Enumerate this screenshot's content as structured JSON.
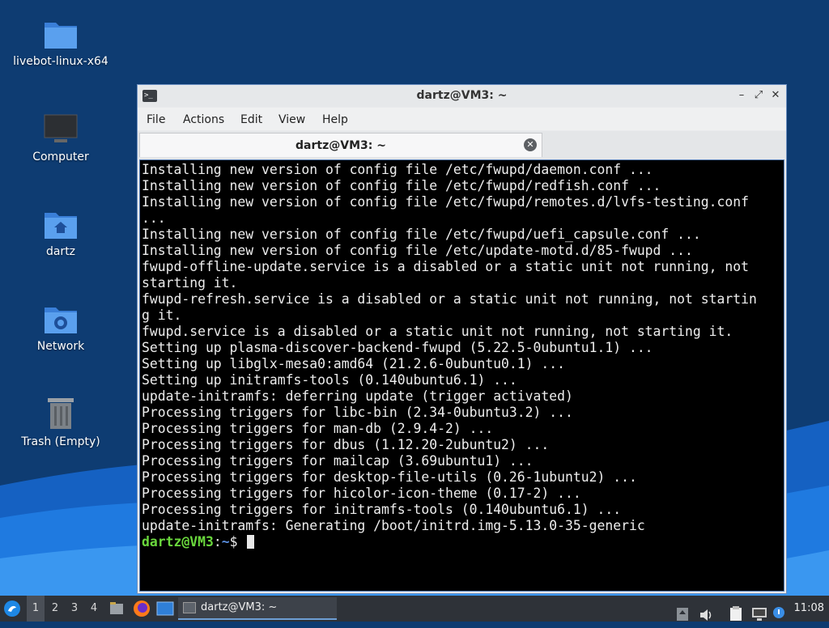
{
  "desktop": {
    "icons": [
      {
        "label": "livebot-linux-x64",
        "icon": "folder-icon"
      },
      {
        "label": "Computer",
        "icon": "computer-icon"
      },
      {
        "label": "dartz",
        "icon": "home-folder-icon"
      },
      {
        "label": "Network",
        "icon": "network-folder-icon"
      },
      {
        "label": "Trash (Empty)",
        "icon": "trash-icon"
      }
    ]
  },
  "window": {
    "title": "dartz@VM3: ~",
    "controls": {
      "minimize": "–",
      "maximize": "⤢",
      "close": "✕"
    },
    "menu": [
      "File",
      "Actions",
      "Edit",
      "View",
      "Help"
    ],
    "tab_title": "dartz@VM3: ~",
    "tab_close": "✕"
  },
  "terminal": {
    "lines": [
      "Installing new version of config file /etc/fwupd/daemon.conf ...",
      "Installing new version of config file /etc/fwupd/redfish.conf ...",
      "Installing new version of config file /etc/fwupd/remotes.d/lvfs-testing.conf",
      "...",
      "Installing new version of config file /etc/fwupd/uefi_capsule.conf ...",
      "Installing new version of config file /etc/update-motd.d/85-fwupd ...",
      "fwupd-offline-update.service is a disabled or a static unit not running, not",
      "starting it.",
      "fwupd-refresh.service is a disabled or a static unit not running, not startin",
      "g it.",
      "fwupd.service is a disabled or a static unit not running, not starting it.",
      "Setting up plasma-discover-backend-fwupd (5.22.5-0ubuntu1.1) ...",
      "Setting up libglx-mesa0:amd64 (21.2.6-0ubuntu0.1) ...",
      "Setting up initramfs-tools (0.140ubuntu6.1) ...",
      "update-initramfs: deferring update (trigger activated)",
      "Processing triggers for libc-bin (2.34-0ubuntu3.2) ...",
      "Processing triggers for man-db (2.9.4-2) ...",
      "Processing triggers for dbus (1.12.20-2ubuntu2) ...",
      "Processing triggers for mailcap (3.69ubuntu1) ...",
      "Processing triggers for desktop-file-utils (0.26-1ubuntu2) ...",
      "Processing triggers for hicolor-icon-theme (0.17-2) ...",
      "Processing triggers for initramfs-tools (0.140ubuntu6.1) ...",
      "update-initramfs: Generating /boot/initrd.img-5.13.0-35-generic"
    ],
    "prompt": {
      "user_host": "dartz@VM3",
      "sep": ":",
      "path": "~",
      "symbol": "$ "
    }
  },
  "taskbar": {
    "workspaces": [
      "1",
      "2",
      "3",
      "4"
    ],
    "active_workspace": "1",
    "task_label": "dartz@VM3: ~",
    "clock": "11:08"
  }
}
